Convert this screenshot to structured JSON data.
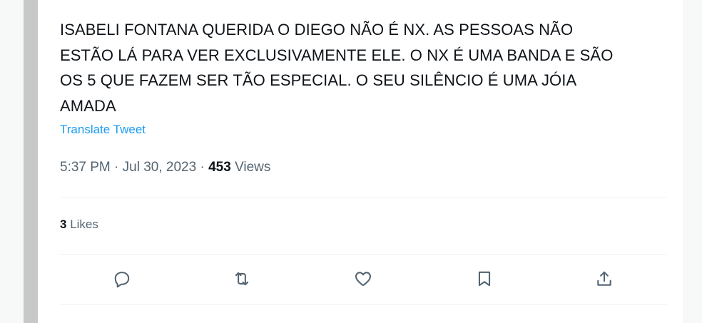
{
  "tweet": {
    "text_lines": [
      "ISABELI FONTANA QUERIDA O DIEGO NÃO É NX. AS PESSOAS NÃO",
      "ESTÃO LÁ PARA VER EXCLUSIVAMENTE ELE. O NX É UMA BANDA E SÃO",
      "OS 5 QUE FAZEM SER TÃO ESPECIAL. O SEU SILÊNCIO É UMA JÓIA",
      "AMADA"
    ],
    "translate_label": "Translate Tweet",
    "time": "5:37 PM",
    "separator": "·",
    "date": "Jul 30, 2023",
    "views_count": "453",
    "views_label": "Views",
    "likes_count": "3",
    "likes_label": "Likes"
  },
  "icons": {
    "reply": "reply-icon",
    "retweet": "retweet-icon",
    "like": "heart-icon",
    "bookmark": "bookmark-icon",
    "share": "share-icon"
  },
  "colors": {
    "text": "#0f1419",
    "secondary": "#536471",
    "link": "#1d9bf0",
    "divider": "#eff3f4"
  }
}
